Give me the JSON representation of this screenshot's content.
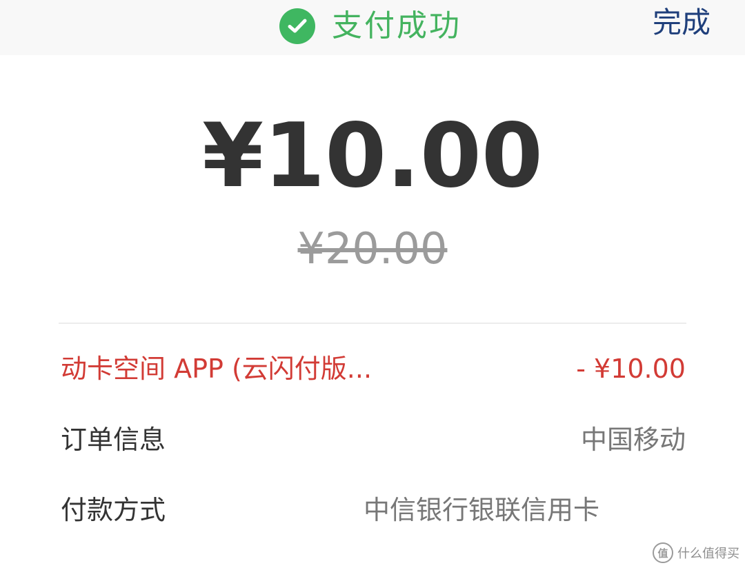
{
  "header": {
    "status_text": "支付成功",
    "done_label": "完成"
  },
  "payment": {
    "amount": "¥10.00",
    "original_amount": "¥20.00"
  },
  "details": [
    {
      "label": "动卡空间 APP (云闪付版...",
      "value": "- ¥10.00"
    },
    {
      "label": "订单信息",
      "value": "中国移动"
    },
    {
      "label": "付款方式",
      "value": "中信银行银联信用卡"
    }
  ],
  "watermark": {
    "text": "什么值得买"
  },
  "colors": {
    "success": "#3fb761",
    "done": "#1f3f7b",
    "discount": "#d23b35",
    "amount": "#333333"
  },
  "icons": [
    "check-circle-icon",
    "watermark-logo-icon"
  ]
}
